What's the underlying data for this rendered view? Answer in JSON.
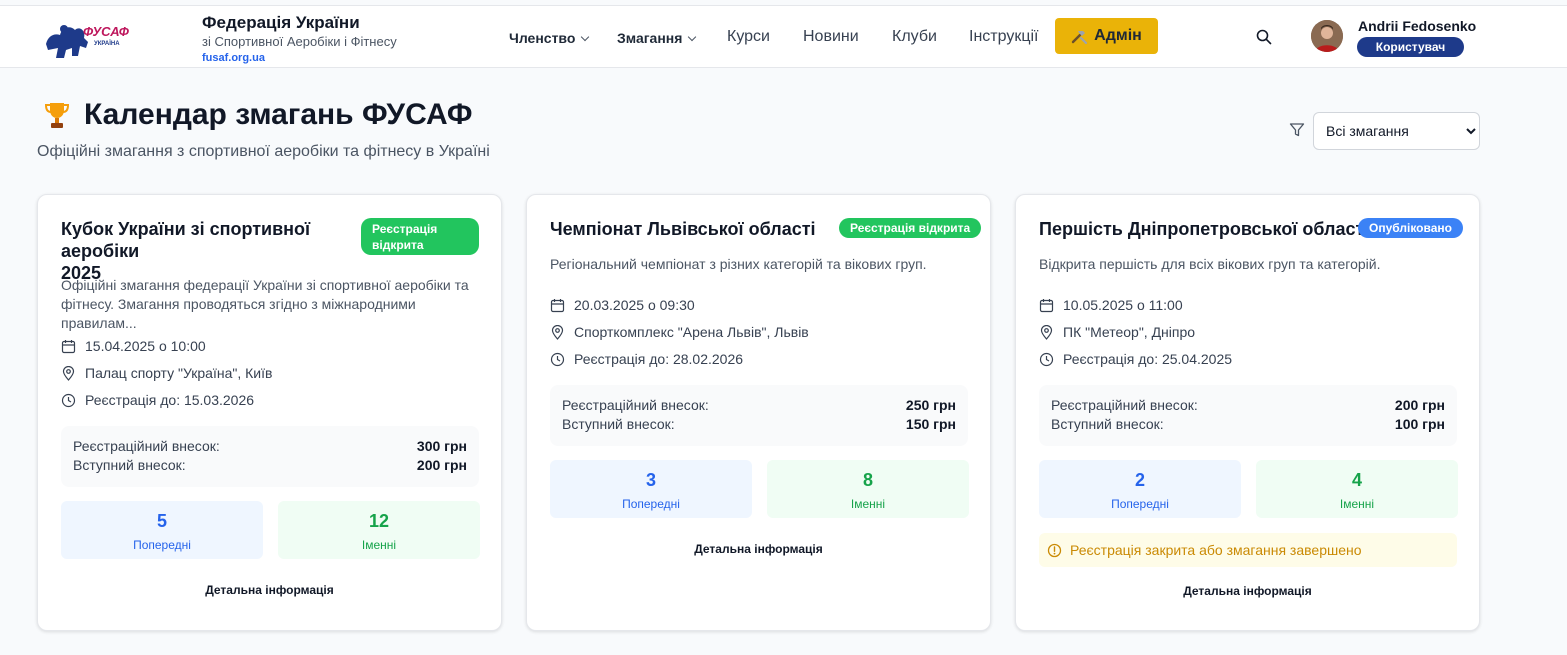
{
  "header": {
    "logo_text": "ФУСАФ",
    "logo_sub": "УКРАЇНА",
    "brand_title": "Федерація України",
    "brand_subtitle": "зі Спортивної Аеробіки і Фітнесу",
    "brand_url": "fusaf.org.ua",
    "nav": [
      {
        "label": "Членство",
        "dropdown": true
      },
      {
        "label": "Змагання",
        "dropdown": true
      },
      {
        "label": "Курси",
        "dropdown": false
      },
      {
        "label": "Новини",
        "dropdown": false
      },
      {
        "label": "Клуби",
        "dropdown": false
      },
      {
        "label": "Інструкції",
        "dropdown": false
      }
    ],
    "admin_label": "Адмін",
    "admin_icon": "hammer-wrench-icon",
    "user_name": "Andrii Fedosenko",
    "user_role": "Користувач",
    "colors": {
      "admin": "#eab308",
      "role_badge": "#1e3a8a",
      "link": "#2563eb"
    }
  },
  "page": {
    "title": "Календар змагань ФУСАФ",
    "subtitle": "Офіційні змагання з спортивної аеробіки та фітнесу в Україні",
    "filter_selected": "Всі змагання"
  },
  "labels": {
    "reg_fee": "Реєстраційний внесок:",
    "entry_fee": "Вступний внесок:",
    "prelim": "Попередні",
    "named": "Іменні",
    "details": "Детальна інформація"
  },
  "cards": [
    {
      "title_line1": "Кубок України зі спортивної аеробіки",
      "title_line2": "2025",
      "badge_line1": "Реєстрація",
      "badge_line2": "відкрита",
      "badge_color": "#22c55e",
      "desc_line1": "Офіційні змагання федерації України зі спортивної аеробіки та",
      "desc_line2": "фітнесу. Змагання проводяться згідно з міжнародними правилам...",
      "date": "15.04.2025 о 10:00",
      "location": "Палац спорту \"Україна\", Київ",
      "deadline": "Реєстрація до: 15.03.2026",
      "reg_fee": "300 грн",
      "entry_fee": "200 грн",
      "prelim_count": "5",
      "named_count": "12"
    },
    {
      "title_line1": "Чемпіонат Львівської області",
      "badge_line1": "Реєстрація відкрита",
      "badge_color": "#22c55e",
      "desc_line1": "Регіональний чемпіонат з різних категорій та вікових груп.",
      "date": "20.03.2025 о 09:30",
      "location": "Спорткомплекс \"Арена Львів\", Львів",
      "deadline": "Реєстрація до: 28.02.2026",
      "reg_fee": "250 грн",
      "entry_fee": "150 грн",
      "prelim_count": "3",
      "named_count": "8"
    },
    {
      "title_line1": "Першість Дніпропетровської області",
      "badge_line1": "Опубліковано",
      "badge_color": "#3b82f6",
      "desc_line1": "Відкрита першість для всіх вікових груп та категорій.",
      "date": "10.05.2025 о 11:00",
      "location": "ПК \"Метеор\", Дніпро",
      "deadline": "Реєстрація до: 25.04.2025",
      "reg_fee": "200 грн",
      "entry_fee": "100 грн",
      "prelim_count": "2",
      "named_count": "4",
      "warning": "Реєстрація закрита або змагання завершено"
    }
  ]
}
